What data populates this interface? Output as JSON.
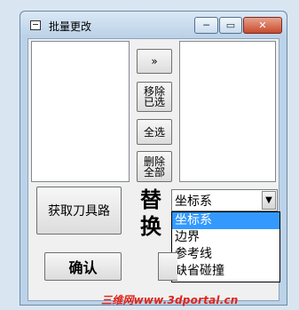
{
  "window": {
    "title": "批量更改",
    "controls": {
      "minimize": "─",
      "maximize": "▭",
      "close": "✕"
    }
  },
  "left_list": {
    "items": []
  },
  "right_list": {
    "items": []
  },
  "buttons": {
    "move": "»",
    "remove_selected": "移除已选",
    "select_all": "全选",
    "delete_all": "删除全部",
    "get_toolpath": "获取刀具路",
    "confirm": "确认"
  },
  "replace_label": "替换",
  "combo": {
    "value": "坐标系",
    "arrow_icon": "chevron-down-icon",
    "options": [
      "坐标系",
      "边界",
      "参考线",
      "缺省碰撞"
    ],
    "highlighted_index": 0
  },
  "watermark": "三维网www.3dportal.cn",
  "colors": {
    "selection": "#3399ff",
    "watermark": "#e0231a"
  }
}
